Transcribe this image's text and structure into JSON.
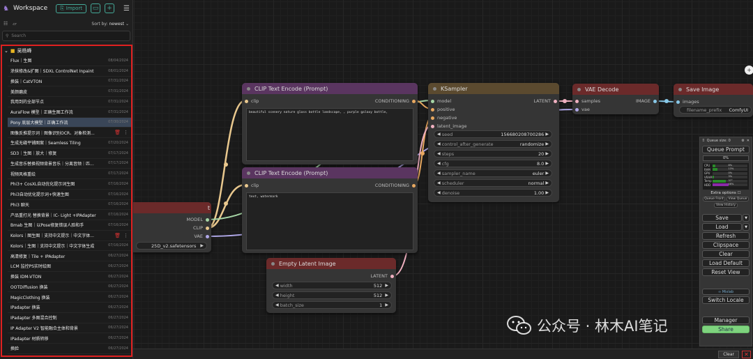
{
  "sidebar": {
    "title": "Workspace",
    "import_label": "Import",
    "sort_prefix": "Sort by:",
    "sort_value": "newest",
    "search_placeholder": "Search",
    "folder_name": "吴杨峰",
    "items": [
      {
        "name": "Flux｜生图",
        "date": "08/04/2024"
      },
      {
        "name": "涂抹修改&扩图｜SDXL ControlNet Inpaint",
        "date": "08/01/2024"
      },
      {
        "name": "换装｜CatVTON",
        "date": "07/31/2024"
      },
      {
        "name": "美颜磨皮",
        "date": "07/31/2024"
      },
      {
        "name": "我用到的全部节点",
        "date": "07/31/2024"
      },
      {
        "name": "AuraFlow 模型｜正确生图工作流",
        "date": "07/31/2024"
      },
      {
        "name": "Pony 底层大模型｜正确工作流",
        "date": "07/30/2024"
      },
      {
        "name": "图像反推提示词｜图像识别OCR、对象检测...",
        "date": ""
      },
      {
        "name": "生成无缝平铺图案｜Seamless Tiling",
        "date": "07/20/2024"
      },
      {
        "name": "SD3｜生图｜放大｜修复",
        "date": "07/17/2024"
      },
      {
        "name": "生成音乐替换视频背景音乐｜分离音频｜匹...",
        "date": "07/17/2024"
      },
      {
        "name": "视频风格重绘",
        "date": "07/17/2024"
      },
      {
        "name": "Phi3+ CosXL自动优化提示词生图",
        "date": "07/16/2024"
      },
      {
        "name": "Phi3自动优化提示词+快速生图",
        "date": "07/16/2024"
      },
      {
        "name": "Phi3 聊天",
        "date": "07/16/2024"
      },
      {
        "name": "产品重打光 替换背景｜IC- Light +IPAdapter",
        "date": "07/16/2024"
      },
      {
        "name": "Bmab 生图｜以Pose修复错误人脸和手",
        "date": "07/16/2024"
      },
      {
        "name": "Kolors｜图生图｜支持中文提示｜中文字体...",
        "date": ""
      },
      {
        "name": "Kolors｜生图｜支持中文提示｜中文字体生成",
        "date": "07/16/2024"
      },
      {
        "name": "高清修复｜Tile + IPAdapter",
        "date": "06/27/2024"
      },
      {
        "name": "LCM 监控PS实时绘图",
        "date": "06/27/2024"
      },
      {
        "name": "换装 IDM-VTON",
        "date": "06/27/2024"
      },
      {
        "name": "OOTDiffusion 换装",
        "date": "06/27/2024"
      },
      {
        "name": "MagicClothing 换装",
        "date": "06/27/2024"
      },
      {
        "name": "IPadapter 换装",
        "date": "06/27/2024"
      },
      {
        "name": "IPadapter 多图混合控制",
        "date": "06/27/2024"
      },
      {
        "name": "IP Adapter V2 智能融合主体和背景",
        "date": "06/27/2024"
      },
      {
        "name": "IPadapter 材质转移",
        "date": "06/27/2024"
      },
      {
        "name": "换脸",
        "date": "06/27/2024"
      }
    ]
  },
  "nodes": {
    "clip1": {
      "title": "CLIP Text Encode (Prompt)",
      "in": "clip",
      "out": "CONDITIONING",
      "text": "beautiful scenery nature glass bottle landscape, , purple galaxy bottle,"
    },
    "clip2": {
      "title": "CLIP Text Encode (Prompt)",
      "in": "clip",
      "out": "CONDITIONING",
      "text": "text, watermark"
    },
    "ckpt": {
      "title": "t",
      "out_model": "MODEL",
      "out_clip": "CLIP",
      "out_vae": "VAE",
      "ckpt_value": "25D_v2.safetensors"
    },
    "ksampler": {
      "title": "KSampler",
      "inputs": [
        "model",
        "positive",
        "negative",
        "latent_image"
      ],
      "out": "LATENT",
      "widgets": [
        {
          "label": "seed",
          "value": "156680208700286"
        },
        {
          "label": "control_after_generate",
          "value": "randomize"
        },
        {
          "label": "steps",
          "value": "20"
        },
        {
          "label": "cfg",
          "value": "8.0"
        },
        {
          "label": "sampler_name",
          "value": "euler"
        },
        {
          "label": "scheduler",
          "value": "normal"
        },
        {
          "label": "denoise",
          "value": "1.00"
        }
      ]
    },
    "vae": {
      "title": "VAE Decode",
      "in1": "samples",
      "in2": "vae",
      "out": "IMAGE"
    },
    "save": {
      "title": "Save Image",
      "in": "images",
      "widget_label": "filename_prefix",
      "widget_value": "ComfyUI"
    },
    "latent": {
      "title": "Empty Latent Image",
      "out": "LATENT",
      "widgets": [
        {
          "label": "width",
          "value": "512"
        },
        {
          "label": "height",
          "value": "512"
        },
        {
          "label": "batch_size",
          "value": "1"
        }
      ]
    }
  },
  "queue": {
    "title": "Queue size: 0",
    "queue_prompt": "Queue Prompt",
    "progress": "0%",
    "stats": [
      {
        "label": "CPU",
        "value": "8%"
      },
      {
        "label": "RAM",
        "value": "13%"
      },
      {
        "label": "GPU",
        "value": "0%"
      },
      {
        "label": "VRAM",
        "value": "3%"
      },
      {
        "label": "Temp",
        "value": "37°"
      },
      {
        "label": "HDD",
        "value": "46%"
      }
    ],
    "extra_options": "Extra options",
    "queue_front": "Queue Front",
    "view_queue": "View Queue",
    "view_history": "View History",
    "save": "Save",
    "load": "Load",
    "refresh": "Refresh",
    "clipspace": "Clipspace",
    "clear": "Clear",
    "load_default": "Load Default",
    "reset_view": "Reset View",
    "mixlab": "∞ Mixlab",
    "switch_locale": "Switch Locale",
    "manager": "Manager",
    "share": "Share"
  },
  "bottom": {
    "clear": "Clear"
  },
  "watermark": {
    "text": "公众号 · 林木AI笔记"
  },
  "colors": {
    "clip_header": "#5a3560",
    "ksampler_header": "#5b4a2f",
    "vae_header": "#6b2a2a",
    "latent_header": "#6b2a2a",
    "ckpt_header": "#6b2a2a",
    "accent": "#44aa88",
    "selection_border": "#e02020"
  }
}
